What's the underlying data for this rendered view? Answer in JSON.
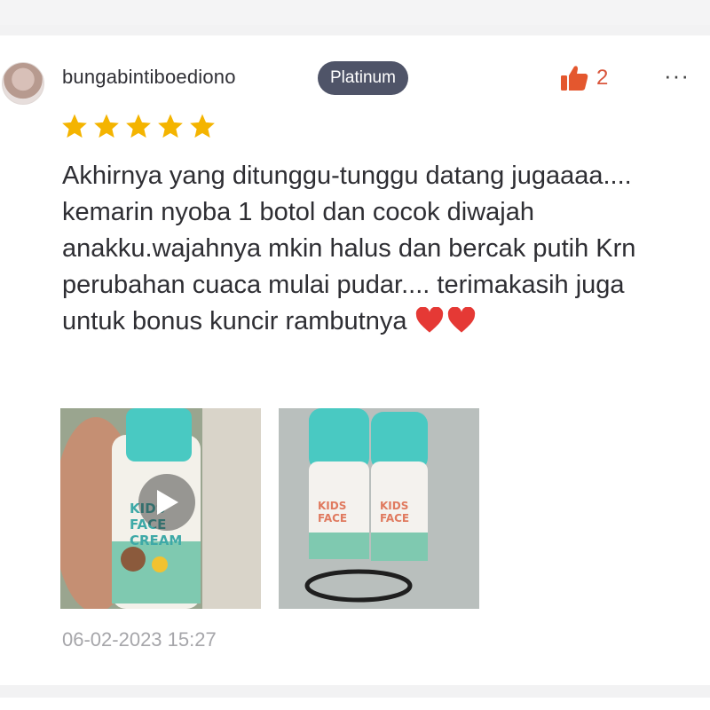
{
  "review": {
    "username": "bungabintiboediono",
    "badge": "Platinum",
    "like_count": "2",
    "more_label": "···",
    "rating": 5,
    "text": "Akhirnya yang ditunggu-tunggu datang jugaaaa.... kemarin nyoba 1 botol dan cocok diwajah anakku.wajahnya mkin halus dan bercak putih Krn perubahan cuaca mulai pudar.... terimakasih juga untuk bonus kuncir rambutnya",
    "timestamp": "06-02-2023 15:27",
    "media": [
      {
        "type": "video",
        "label_lines": [
          "KIDS",
          "FACE",
          "CREAM"
        ]
      },
      {
        "type": "image",
        "label_lines": [
          "KIDS",
          "FACE"
        ]
      }
    ]
  },
  "colors": {
    "accent": "#e4572e",
    "badge_bg": "#4f5468",
    "star": "#f4b400",
    "heart": "#e53935",
    "bottle_teal": "#49c9c2"
  }
}
